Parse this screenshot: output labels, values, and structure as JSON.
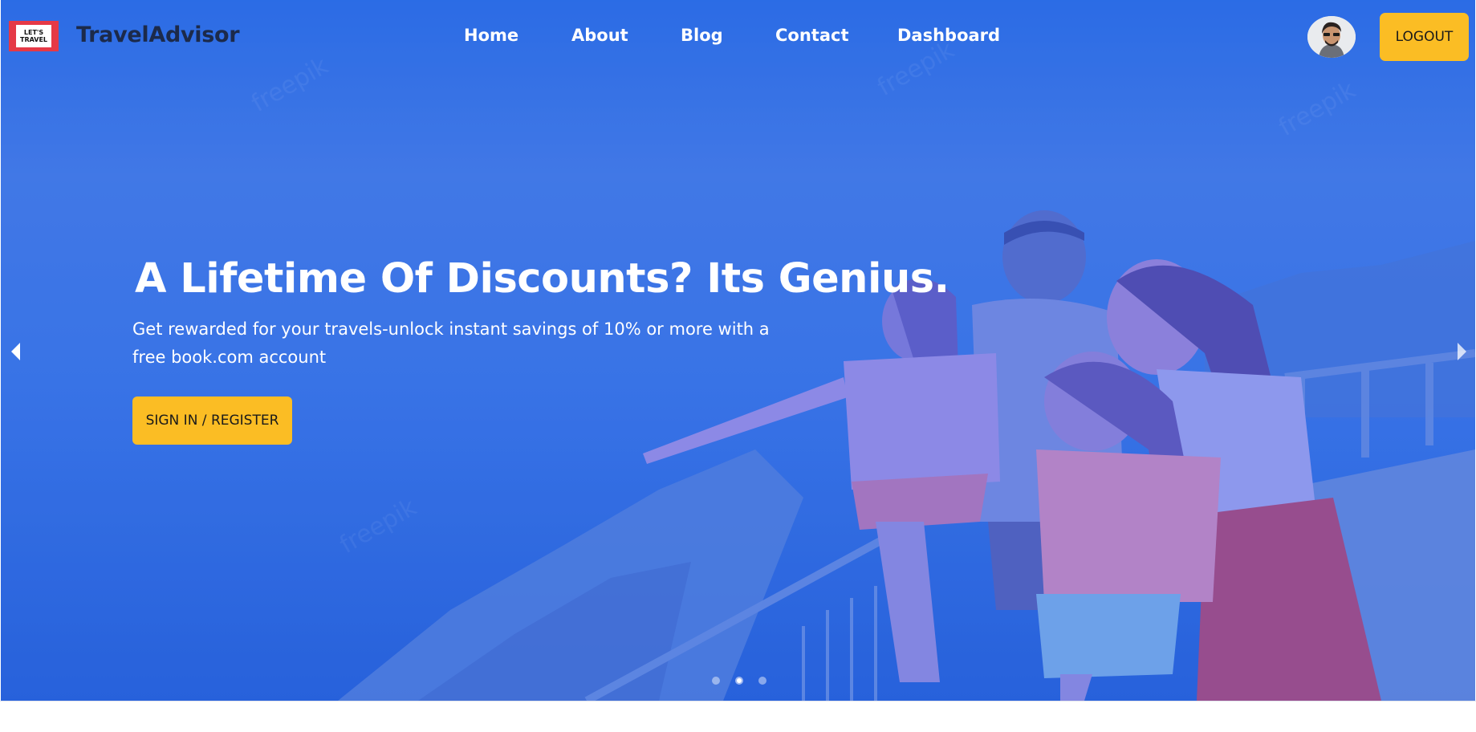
{
  "logo": {
    "line1": "LET'S",
    "line2": "TRAVEL",
    "brand": "TravelAdvisor"
  },
  "nav": {
    "items": [
      {
        "label": "Home"
      },
      {
        "label": "About"
      },
      {
        "label": "Blog"
      },
      {
        "label": "Contact"
      },
      {
        "label": "Dashboard"
      }
    ],
    "logout_label": "LOGOUT",
    "avatar_icon": "user-avatar"
  },
  "hero": {
    "title": "A Lifetime Of Discounts? Its Genius.",
    "subtitle": "Get rewarded for your travels-unlock instant savings of 10% or more with a free book.com account",
    "cta_label": "SIGN IN / REGISTER",
    "prev_icon": "caret-left-icon",
    "next_icon": "caret-right-icon",
    "slides": {
      "count": 3,
      "active": 2
    }
  },
  "colors": {
    "accent": "#fbbd24",
    "hero_overlay": "#2f6fe4",
    "brand_text": "#1c2a4a",
    "logo_red": "#e53946"
  }
}
